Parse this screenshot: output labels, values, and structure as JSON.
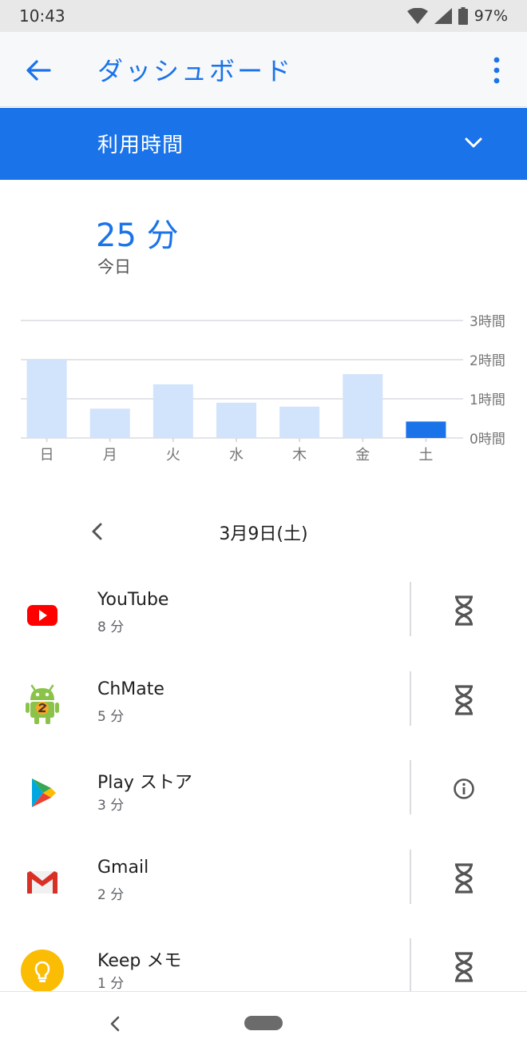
{
  "status_bar": {
    "time": "10:43",
    "battery": "97%"
  },
  "app_bar": {
    "title": "ダッシュボード",
    "back_icon": "arrow-back-icon",
    "more_icon": "more-vert-icon"
  },
  "selector": {
    "label": "利用時間",
    "icon": "chevron-down-icon"
  },
  "summary": {
    "total": "25 分",
    "period": "今日"
  },
  "chart_data": {
    "type": "bar",
    "categories": [
      "日",
      "月",
      "火",
      "水",
      "木",
      "金",
      "土"
    ],
    "values": [
      2.0,
      0.75,
      1.37,
      0.9,
      0.8,
      1.63,
      0.42
    ],
    "y_tick_labels": [
      "0時間",
      "1時間",
      "2時間",
      "3時間"
    ],
    "ylim": [
      0,
      3
    ],
    "highlight_index": 6,
    "colors": {
      "bar": "#d2e3fc",
      "highlight": "#1a73e8",
      "grid": "#dadce0"
    },
    "grid": true
  },
  "date_nav": {
    "date": "3月9日(土)",
    "prev_icon": "chevron-left-icon"
  },
  "apps": [
    {
      "name": "YouTube",
      "time": "8 分",
      "icon": "youtube-icon",
      "action_icon": "hourglass-icon"
    },
    {
      "name": "ChMate",
      "time": "5 分",
      "icon": "chmate-icon",
      "action_icon": "hourglass-icon"
    },
    {
      "name": "Play ストア",
      "time": "3 分",
      "icon": "play-store-icon",
      "action_icon": "info-icon"
    },
    {
      "name": "Gmail",
      "time": "2 分",
      "icon": "gmail-icon",
      "action_icon": "hourglass-icon"
    },
    {
      "name": "Keep メモ",
      "time": "1 分",
      "icon": "keep-icon",
      "action_icon": "hourglass-icon"
    }
  ],
  "colors": {
    "accent": "#1a73e8"
  }
}
